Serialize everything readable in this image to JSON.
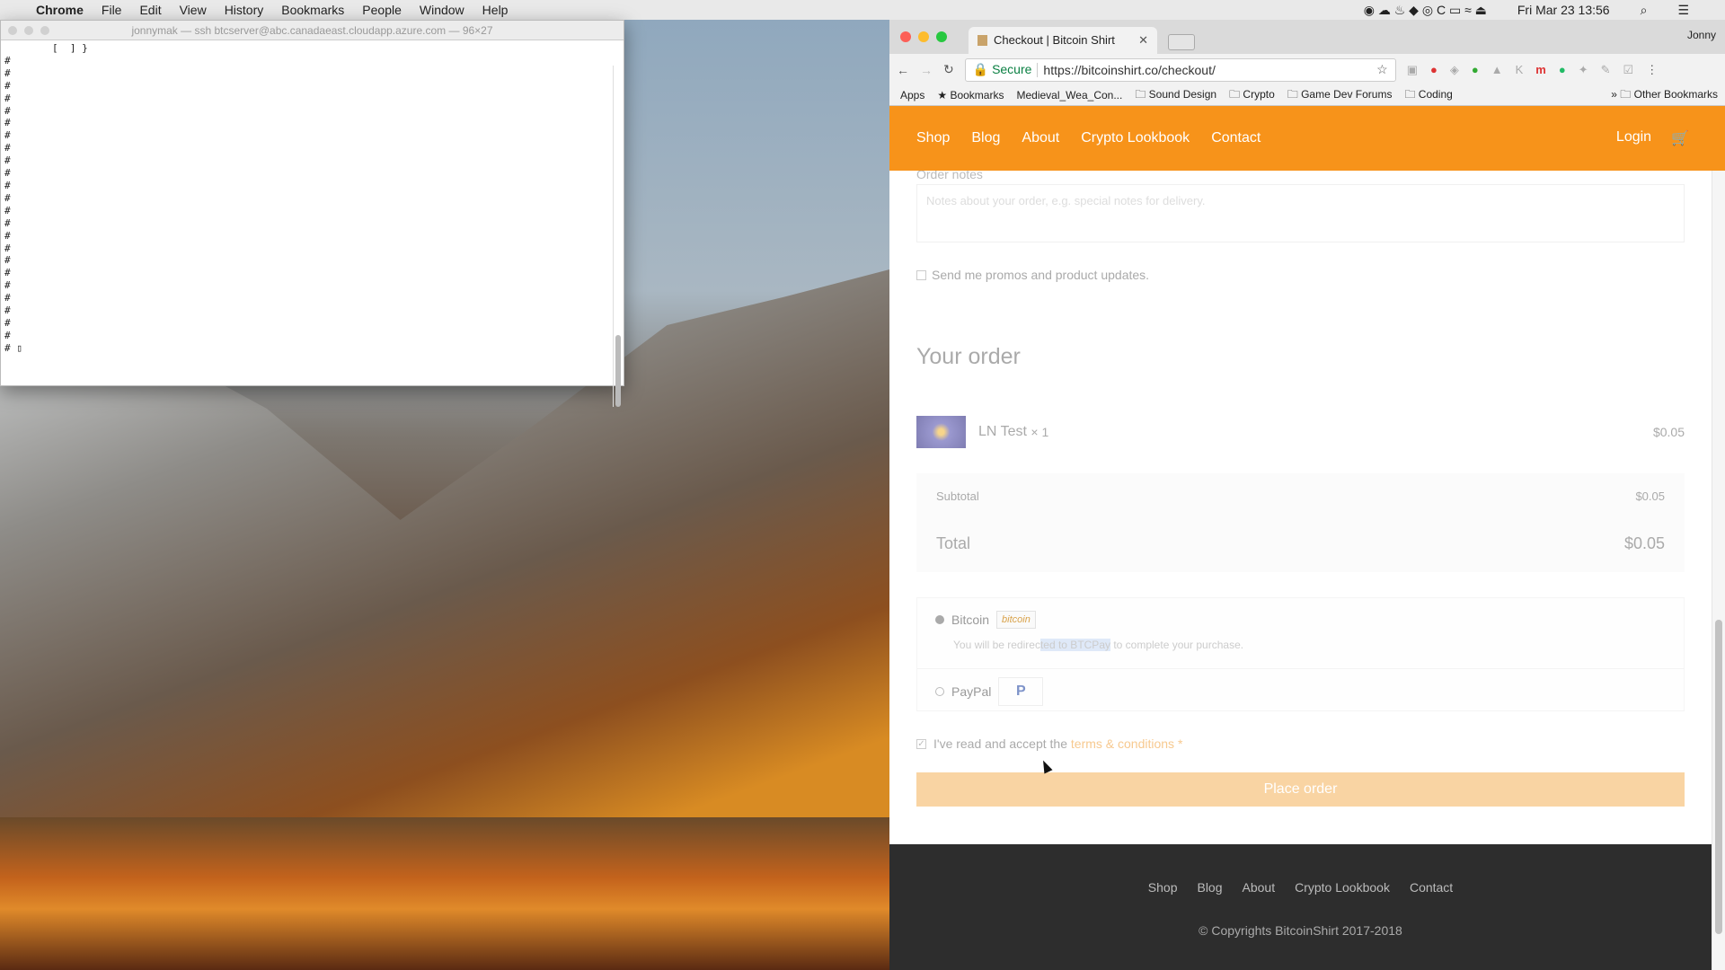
{
  "menubar": {
    "apple": "",
    "app": "Chrome",
    "items": [
      "File",
      "Edit",
      "View",
      "History",
      "Bookmarks",
      "People",
      "Window",
      "Help"
    ],
    "clock": "Fri Mar 23  13:56"
  },
  "terminal": {
    "title": "jonnymak — ssh btcserver@abc.canadaeast.cloudapp.azure.com — 96×27",
    "content": "        [  ] }\n#\n#\n#\n#\n#\n#\n#\n#\n#\n#\n#\n#\n#\n#\n#\n#\n#\n#\n#\n#\n#\n#\n#\n# ▯"
  },
  "browser": {
    "tab_title": "Checkout | Bitcoin Shirt",
    "profile": "Jonny",
    "secure": "Secure",
    "url": "https://bitcoinshirt.co/checkout/",
    "bookmarks": [
      "Apps",
      "Bookmarks",
      "Medieval_Wea_Con...",
      "Sound Design",
      "Crypto",
      "Game Dev Forums",
      "Coding"
    ],
    "other_bookmarks": "Other Bookmarks"
  },
  "site": {
    "nav": [
      "Shop",
      "Blog",
      "About",
      "Crypto Lookbook",
      "Contact"
    ],
    "login": "Login",
    "notes_label": "Order notes",
    "notes_placeholder": "Notes about your order, e.g. special notes for delivery.",
    "promo": "Send me promos and product updates.",
    "your_order": "Your order",
    "item": {
      "name": "LN Test",
      "qty": "× 1",
      "price": "$0.05"
    },
    "subtotal_label": "Subtotal",
    "subtotal": "$0.05",
    "total_label": "Total",
    "total": "$0.05",
    "payment": {
      "bitcoin": "Bitcoin",
      "bitcoin_logo": "bitcoin",
      "desc_a": "You will be redirec",
      "desc_hl": "ted to BTCPay",
      "desc_b": " to complete your purchase.",
      "paypal": "PayPal",
      "paypal_logo": "P"
    },
    "terms_a": "I've read and accept the ",
    "terms_link": "terms & conditions",
    "terms_req": " *",
    "place_order": "Place order",
    "footer_links": [
      "Shop",
      "Blog",
      "About",
      "Crypto Lookbook",
      "Contact"
    ],
    "copyright": "© Copyrights BitcoinShirt 2017-2018"
  },
  "colors": {
    "brand": "#f7931a",
    "footer": "#2d2d2d"
  }
}
